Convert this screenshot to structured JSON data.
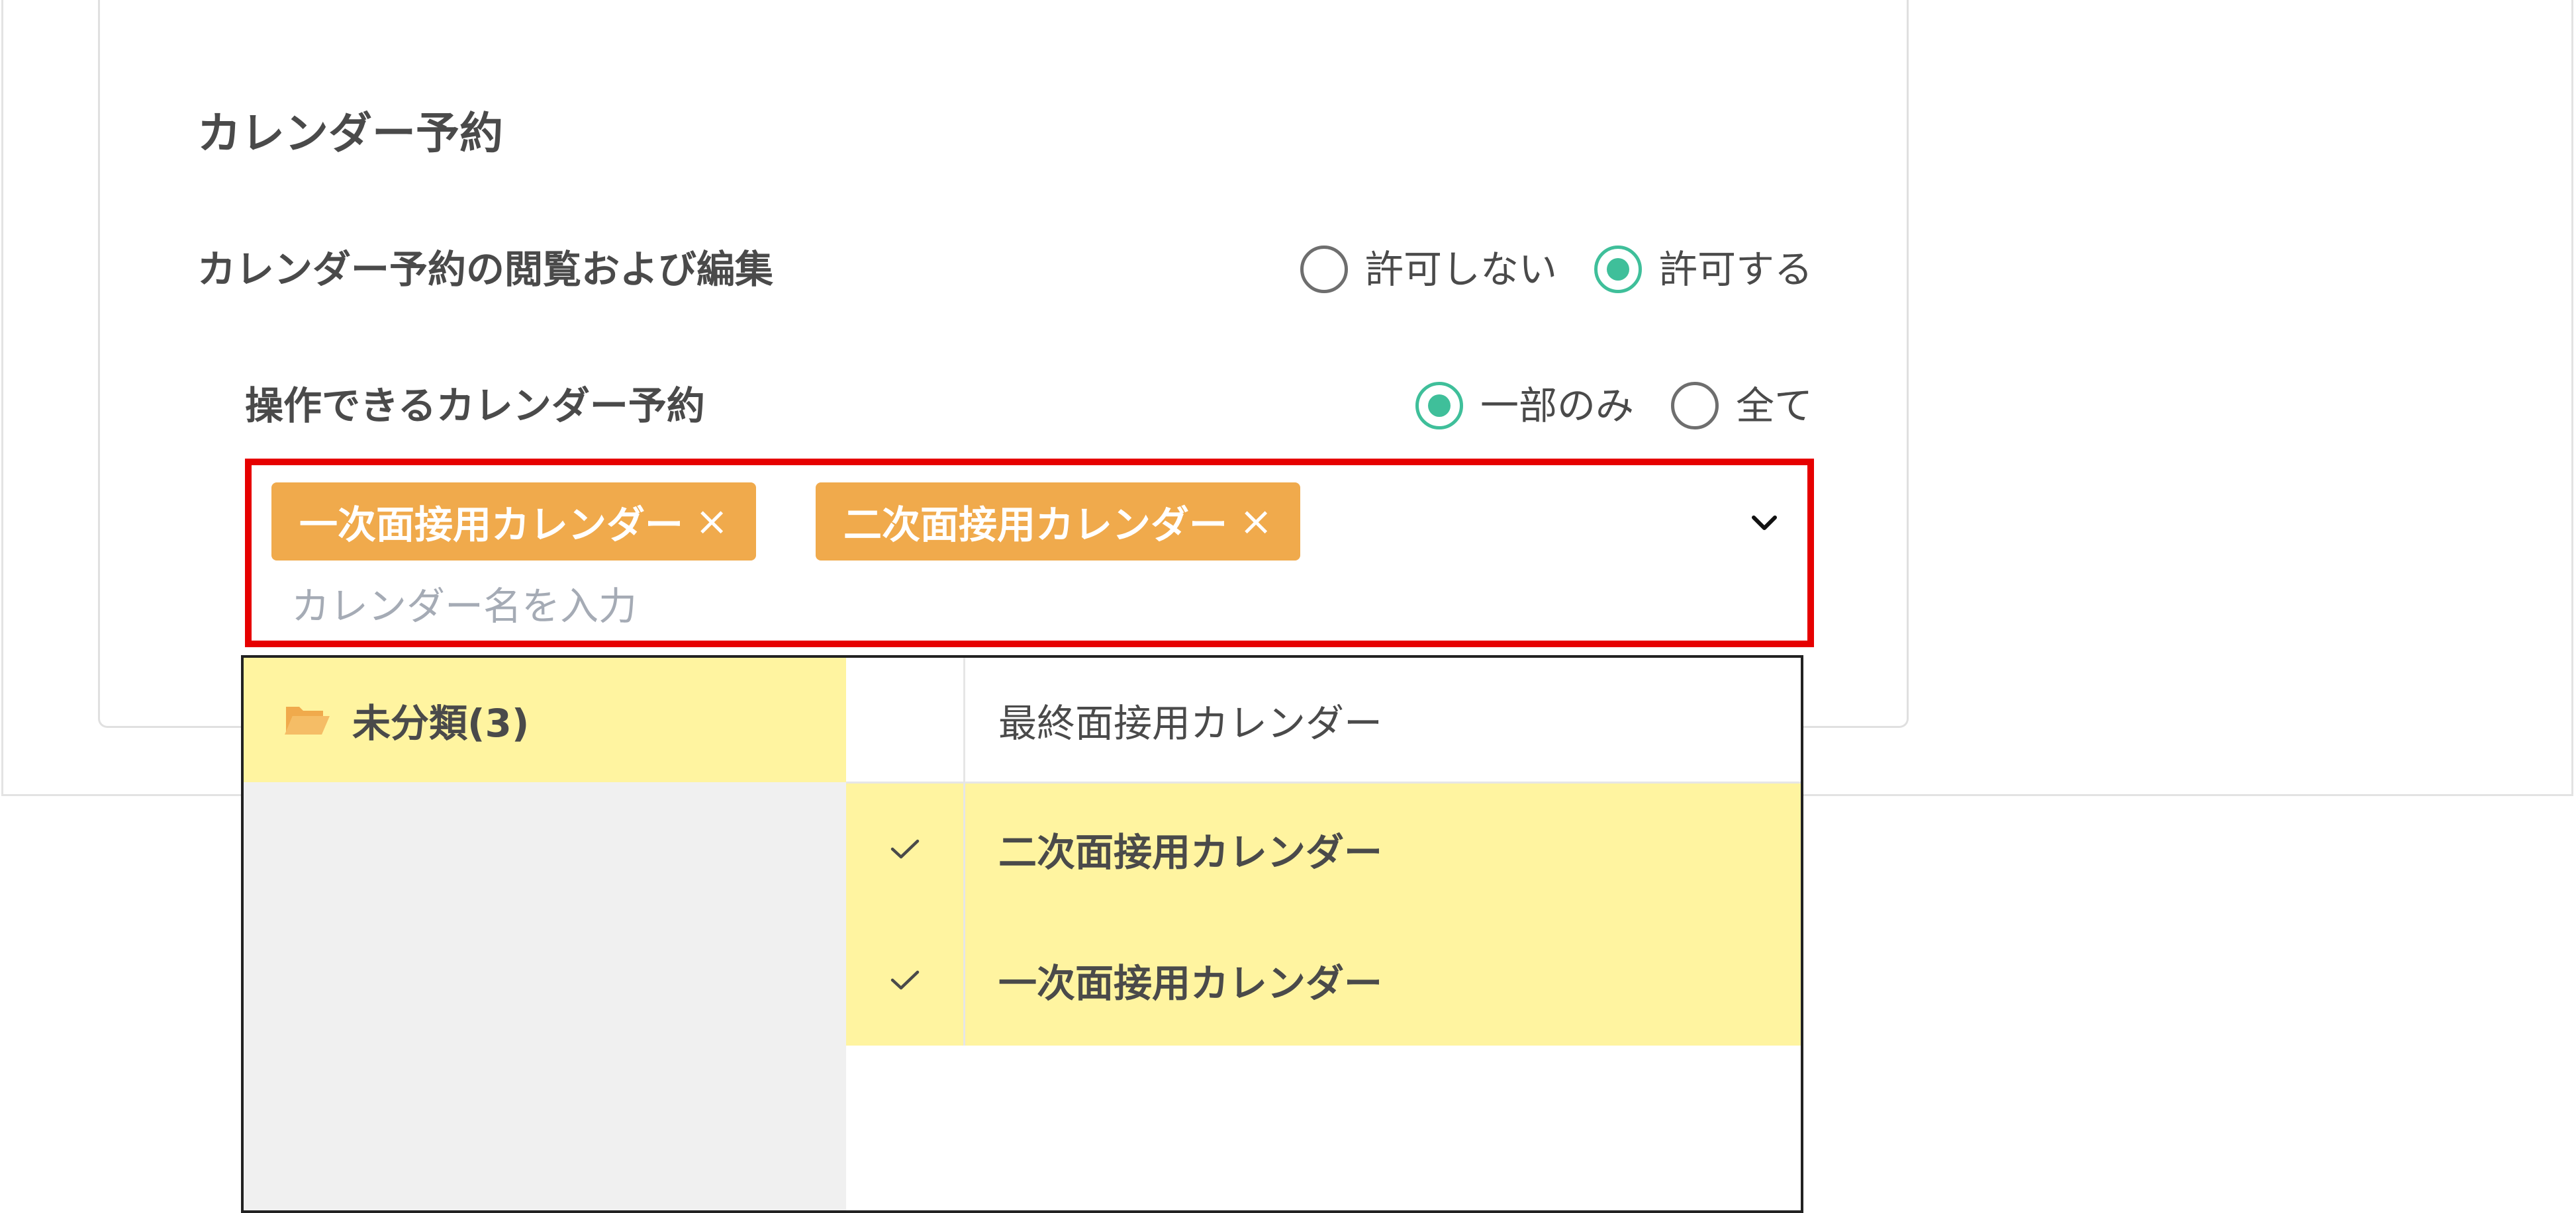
{
  "section": {
    "title": "カレンダー予約"
  },
  "view_edit": {
    "label": "カレンダー予約の閲覧および編集",
    "options": [
      {
        "label": "許可しない",
        "checked": false
      },
      {
        "label": "許可する",
        "checked": true
      }
    ]
  },
  "operable": {
    "label": "操作できるカレンダー予約",
    "options": [
      {
        "label": "一部のみ",
        "checked": true
      },
      {
        "label": "全て",
        "checked": false
      }
    ]
  },
  "selector": {
    "chips": [
      {
        "label": "一次面接用カレンダー",
        "remove": "×"
      },
      {
        "label": "二次面接用カレンダー",
        "remove": "×"
      }
    ],
    "placeholder": "カレンダー名を入力"
  },
  "dropdown": {
    "folders": [
      {
        "label": "未分類(3)",
        "icon": "folder-open-icon"
      }
    ],
    "calendars": [
      {
        "label": "最終面接用カレンダー",
        "selected": false
      },
      {
        "label": "二次面接用カレンダー",
        "selected": true
      },
      {
        "label": "一次面接用カレンダー",
        "selected": true
      }
    ]
  },
  "colors": {
    "accent": "#3fbf9a",
    "chip": "#f0aa4c",
    "highlight": "#fff4a0",
    "focus_border": "#e60000"
  }
}
